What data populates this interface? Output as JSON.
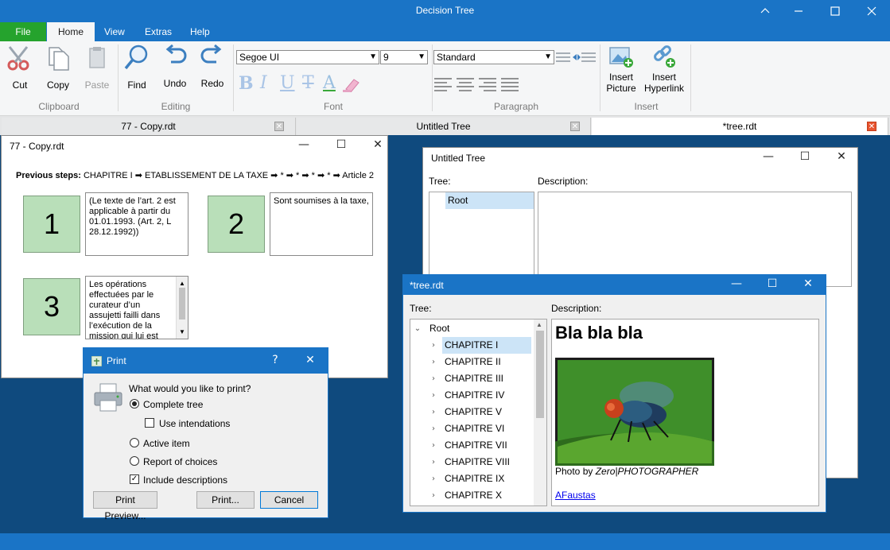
{
  "app": {
    "title": "Decision Tree",
    "controls": {
      "minimize": "—",
      "maximize": "☐",
      "close": "✕"
    }
  },
  "menu": {
    "items": [
      "File",
      "Home",
      "View",
      "Extras",
      "Help"
    ],
    "active": "Home"
  },
  "ribbon": {
    "clipboard": {
      "label": "Clipboard",
      "cut": "Cut",
      "copy": "Copy",
      "paste": "Paste"
    },
    "editing": {
      "label": "Editing",
      "find": "Find",
      "undo": "Undo",
      "redo": "Redo"
    },
    "font": {
      "label": "Font",
      "family": "Segoe UI",
      "size": "9",
      "styles": [
        "B",
        "I",
        "U",
        "T",
        "A"
      ]
    },
    "paragraph": {
      "label": "Paragraph",
      "style": "Standard"
    },
    "insert": {
      "label": "Insert",
      "picture": "Insert\nPicture",
      "hyperlink": "Insert\nHyperlink"
    }
  },
  "doc_tabs": [
    {
      "label": "77 - Copy.rdt",
      "active": false
    },
    {
      "label": "Untitled Tree",
      "active": false
    },
    {
      "label": "*tree.rdt",
      "active": true
    }
  ],
  "win_copy": {
    "title": "77 - Copy.rdt",
    "previous_label": "Previous steps:",
    "previous_path": "CHAPITRE I ➡ ETABLISSEMENT DE LA TAXE ➡ * ➡ * ➡ * ➡ * ➡ Article 2",
    "items": [
      {
        "num": "1",
        "text": "(Le texte de l’art. 2 est applicable à partir du 01.01.1993. (Art. 2, L 28.12.1992))"
      },
      {
        "num": "2",
        "text": "Sont soumises à la taxe,"
      },
      {
        "num": "3",
        "text": "Les opérations effectuées par le curateur d’un assujetti failli dans l’exécution de la mission qui lui est"
      }
    ]
  },
  "win_untitled": {
    "title": "Untitled Tree",
    "tree_label": "Tree:",
    "desc_label": "Description:",
    "root": "Root"
  },
  "win_tree": {
    "title": "*tree.rdt",
    "tree_label": "Tree:",
    "desc_label": "Description:",
    "root": "Root",
    "children": [
      "CHAPITRE I",
      "CHAPITRE II",
      "CHAPITRE III",
      "CHAPITRE IV",
      "CHAPITRE V",
      "CHAPITRE VI",
      "CHAPITRE VII",
      "CHAPITRE VIII",
      "CHAPITRE IX",
      "CHAPITRE X"
    ],
    "heading": "Bla bla bla",
    "caption_prefix": "Photo by ",
    "caption_italic": "Zero|PHOTOGRAPHER",
    "link": "AFaustas"
  },
  "print_dialog": {
    "title": "Print",
    "help": "?",
    "close": "✕",
    "question": "What would you like to print?",
    "complete_tree": "Complete tree",
    "use_intendations": "Use intendations",
    "active_item": "Active item",
    "report": "Report of choices",
    "include_desc": "Include descriptions",
    "preview_btn": "Print Preview...",
    "print_btn": "Print...",
    "cancel_btn": "Cancel"
  },
  "colors": {
    "accent": "#1a74c6",
    "file_tab": "#25a32d",
    "mdi_bg": "#0f4a7e",
    "num_box": "#b9dfb9"
  }
}
